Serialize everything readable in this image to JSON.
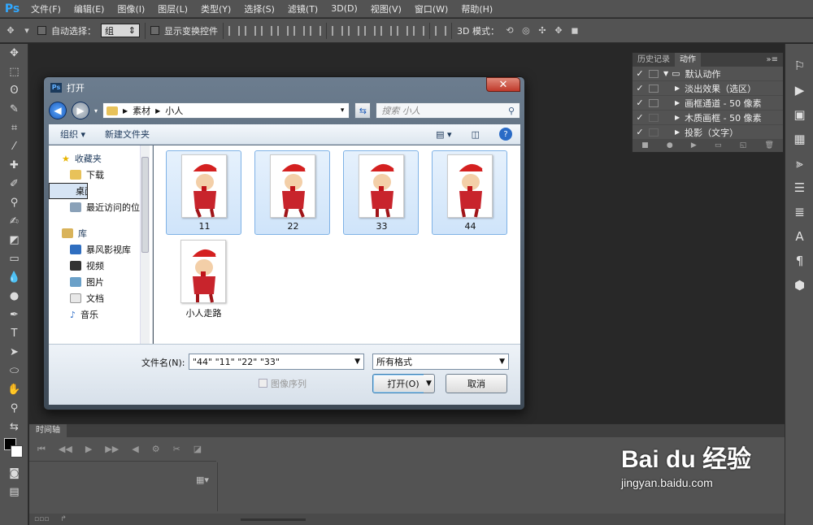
{
  "app": {
    "logo": "Ps"
  },
  "menu": [
    "文件(F)",
    "编辑(E)",
    "图像(I)",
    "图层(L)",
    "类型(Y)",
    "选择(S)",
    "滤镜(T)",
    "3D(D)",
    "视图(V)",
    "窗口(W)",
    "帮助(H)"
  ],
  "options": {
    "auto_select_label": "自动选择：",
    "auto_select_value": "组",
    "show_transform_label": "显示变换控件",
    "mode3d_label": "3D 模式："
  },
  "panel": {
    "tabs": [
      "历史记录",
      "动作"
    ],
    "rows": [
      "默认动作",
      "淡出效果（选区）",
      "画框通道 - 50 像素",
      "木质画框 - 50 像素",
      "投影（文字）"
    ]
  },
  "timeline": {
    "tab": "时间轴"
  },
  "dialog": {
    "title": "打开",
    "breadcrumb": [
      "素材",
      "小人"
    ],
    "search_placeholder": "搜索 小人",
    "organize": "组织 ▾",
    "new_folder": "新建文件夹",
    "nav": {
      "favorites": "收藏夹",
      "downloads": "下载",
      "desktop": "桌面",
      "recent": "最近访问的位置",
      "libraries": "库",
      "storm": "暴风影视库",
      "videos": "视频",
      "pictures": "图片",
      "documents": "文档",
      "music": "音乐"
    },
    "files": [
      {
        "name": "11",
        "selected": true
      },
      {
        "name": "22",
        "selected": true
      },
      {
        "name": "33",
        "selected": true
      },
      {
        "name": "44",
        "selected": true
      },
      {
        "name": "小人走路",
        "selected": false
      }
    ],
    "filename_label": "文件名(N):",
    "filename_value": "\"44\" \"11\" \"22\" \"33\"",
    "filetype_value": "所有格式",
    "image_sequence": "图像序列",
    "open_btn": "打开(O)",
    "cancel_btn": "取消"
  },
  "watermark": {
    "logo": "Bai du 经验",
    "url": "jingyan.baidu.com"
  },
  "colors": {
    "ui_bg": "#535353",
    "canvas_bg": "#282828",
    "accent": "#31a8ff",
    "select_blue": "#cfe4fa"
  }
}
